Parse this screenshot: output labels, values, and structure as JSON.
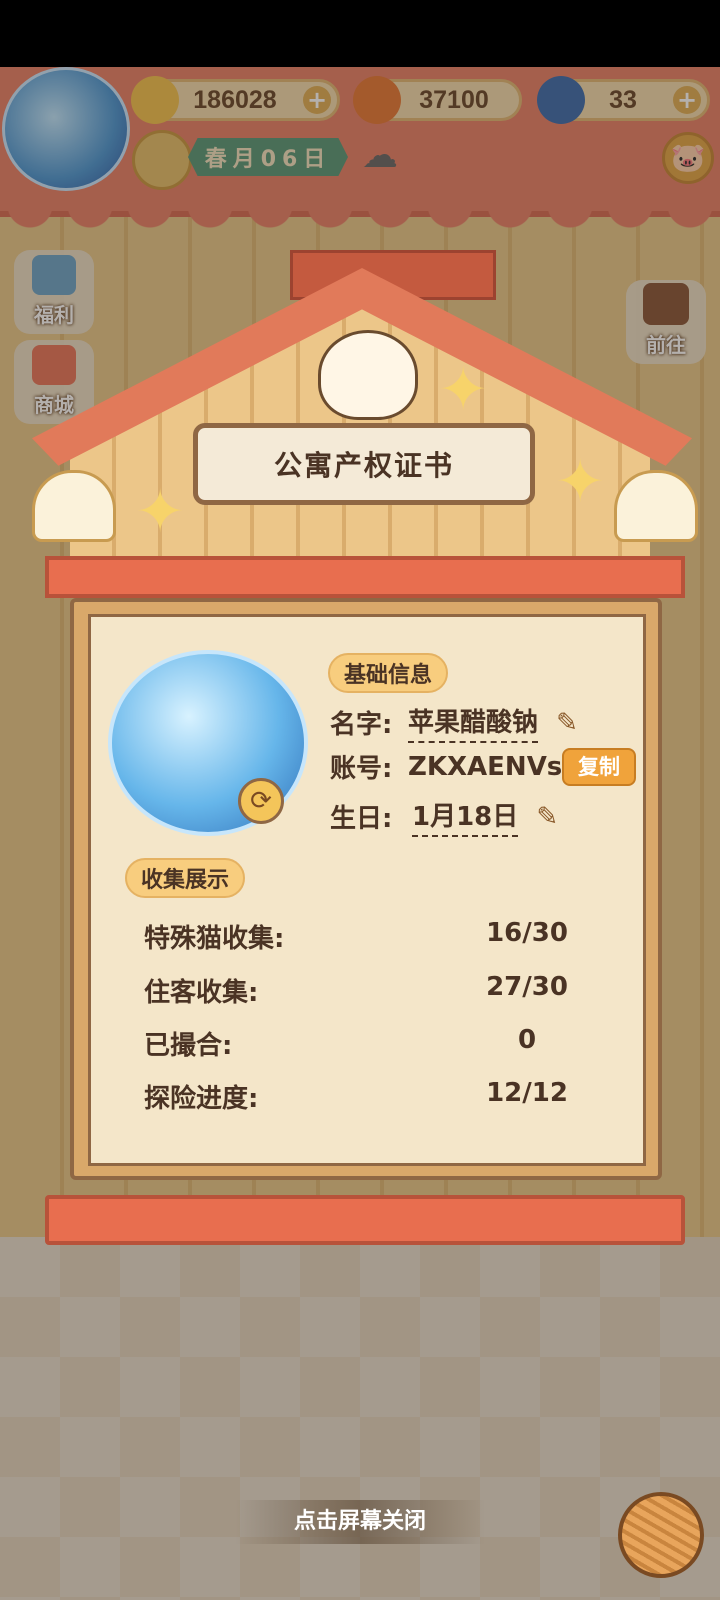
{
  "hud": {
    "resources": [
      {
        "name": "banana-coin",
        "value": "186028",
        "has_plus": true
      },
      {
        "name": "fire-banana",
        "value": "37100",
        "has_plus": false
      },
      {
        "name": "blue-banana",
        "value": "33",
        "has_plus": true
      }
    ],
    "plus": "+",
    "date": "春月06日",
    "weather_icon": "☁",
    "piggy_icon": "🐷"
  },
  "left_menu": [
    {
      "label": "福利"
    },
    {
      "label": "商城"
    }
  ],
  "right_menu": {
    "label": "前往"
  },
  "certificate": {
    "title": "公寓产权证书",
    "basic_info_label": "基础信息",
    "name_key": "名字:",
    "name_value": "苹果醋酸钠",
    "account_key": "账号:",
    "account_value": "ZKXAENVs",
    "copy_label": "复制",
    "birthday_key": "生日:",
    "birthday_value": "1月18日",
    "collection_label": "收集展示",
    "stats": [
      {
        "label": "特殊猫收集:",
        "value": "16/30"
      },
      {
        "label": "住客收集:",
        "value": "27/30"
      },
      {
        "label": "已撮合:",
        "value": "0"
      },
      {
        "label": "探险进度:",
        "value": "12/12"
      }
    ]
  },
  "footer": {
    "close_hint": "点击屏幕关闭"
  },
  "colors": {
    "roof": "#e17a5a",
    "panel": "#f4e6c9",
    "accent": "#f0a33b"
  }
}
